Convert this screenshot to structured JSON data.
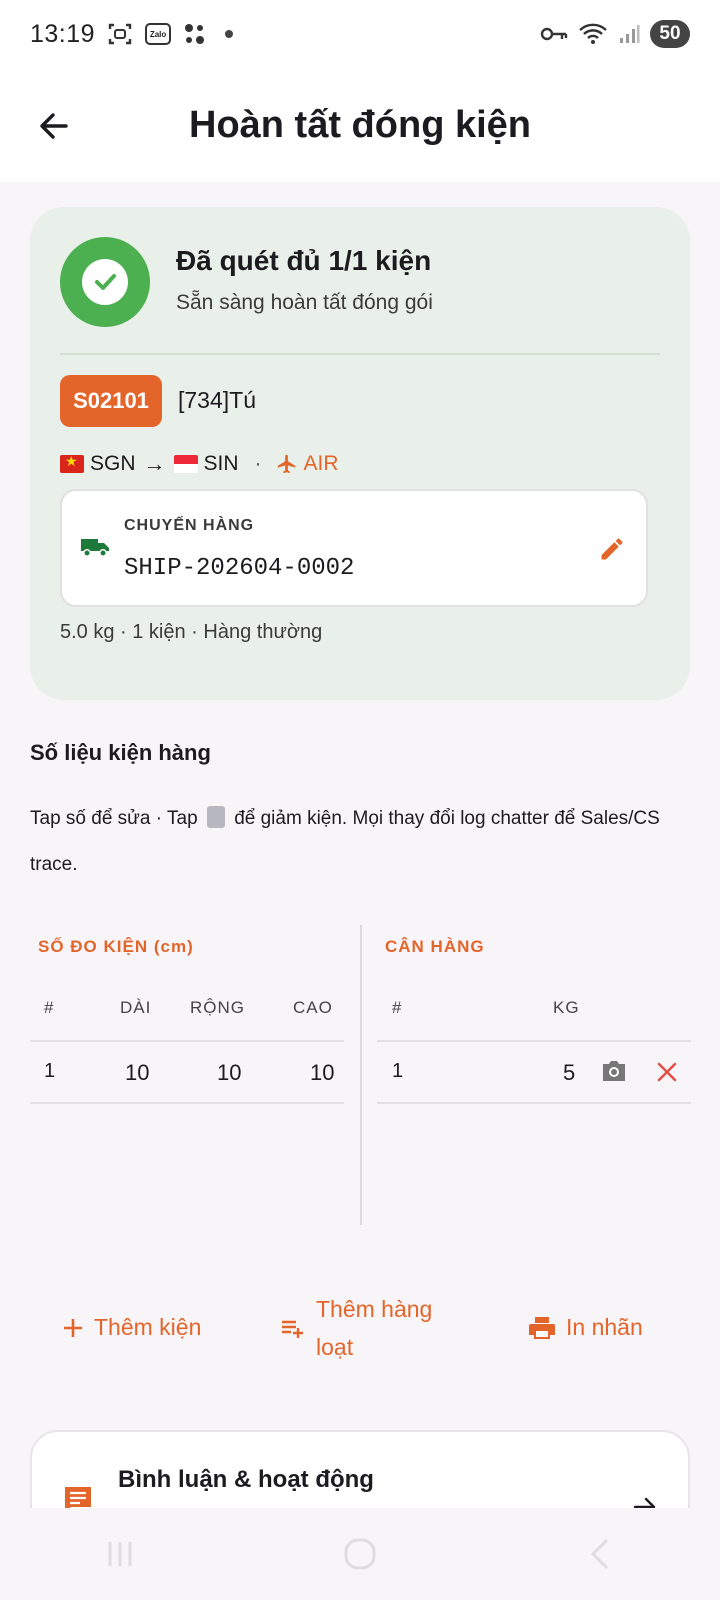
{
  "status_bar": {
    "time": "13:19",
    "battery": "50",
    "icons": [
      "screenshot-icon",
      "zalo-icon",
      "apps-icon",
      "dot-icon",
      "key-icon",
      "wifi-icon",
      "signal-icon"
    ]
  },
  "app_bar": {
    "title": "Hoàn tất đóng kiện",
    "back_icon": "arrow-left-icon"
  },
  "summary": {
    "scan_title": "Đã quét đủ 1/1 kiện",
    "scan_subtitle": "Sẵn sàng hoàn tất đóng gói",
    "order_code": "S02101",
    "customer": "[734]Tú",
    "route": {
      "from": "SGN",
      "to": "SIN",
      "arrow": "→",
      "separator": "·",
      "mode": "AIR"
    },
    "shipment": {
      "label": "CHUYẾN HÀNG",
      "value": "SHIP-202604-0002"
    },
    "meta": "5.0 kg · 1 kiện · Hàng thường"
  },
  "measurements": {
    "title": "Số liệu kiện hàng",
    "help_before": "Tap số để sửa · Tap",
    "help_after": "để giảm kiện. Mọi thay đổi log chatter để Sales/CS trace.",
    "dimensions": {
      "title": "SỐ ĐO KIỆN (cm)",
      "headers": [
        "#",
        "DÀI",
        "RỘNG",
        "CAO"
      ],
      "rows": [
        {
          "index": "1",
          "length": "10",
          "width": "10",
          "height": "10"
        }
      ]
    },
    "weights": {
      "title": "CÂN HÀNG",
      "headers": [
        "#",
        "KG"
      ],
      "rows": [
        {
          "index": "1",
          "kg": "5"
        }
      ]
    }
  },
  "actions": {
    "add_package": "Thêm kiện",
    "add_bulk_line1": "Thêm hàng",
    "add_bulk_line2": "loạt",
    "print_label": "In nhãn"
  },
  "comments": {
    "title": "Bình luận & hoạt động"
  },
  "colors": {
    "accent": "#e4652a",
    "success": "#4caf50",
    "card_bg": "#e9efe9",
    "page_bg": "#f8f5f9"
  }
}
